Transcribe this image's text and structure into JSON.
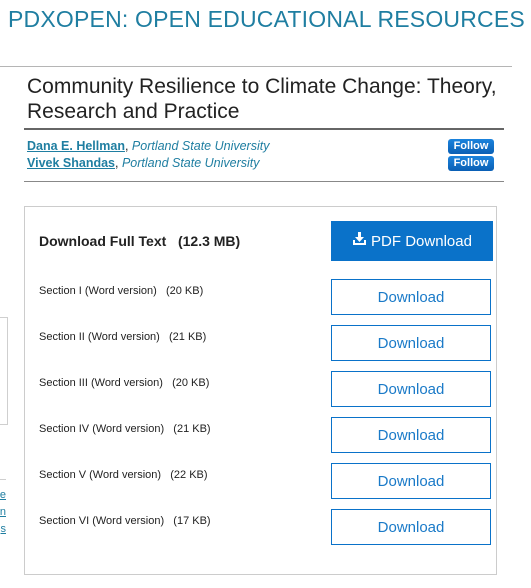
{
  "site": {
    "header": "PDXOPEN: OPEN EDUCATIONAL RESOURCES"
  },
  "book": {
    "title": "Community Resilience to Climate Change: Theory, Research and Practice"
  },
  "authors": [
    {
      "name": "Dana E. Hellman",
      "separator": ", ",
      "affiliation": "Portland State University",
      "follow_label": "Follow"
    },
    {
      "name": "Vivek Shandas",
      "separator": ", ",
      "affiliation": "Portland State University",
      "follow_label": "Follow"
    }
  ],
  "downloads": {
    "full_text_label": "Download Full Text",
    "full_text_size": "(12.3 MB)",
    "pdf_button_label": "PDF Download",
    "pdf_icon": "download-tray-icon",
    "sections": [
      {
        "label": "Section I (Word version)",
        "size": "(20 KB)",
        "button_label": "Download"
      },
      {
        "label": "Section II (Word version)",
        "size": "(21 KB)",
        "button_label": "Download"
      },
      {
        "label": "Section III (Word version)",
        "size": "(20 KB)",
        "button_label": "Download"
      },
      {
        "label": "Section IV (Word version)",
        "size": "(21 KB)",
        "button_label": "Download"
      },
      {
        "label": "Section V (Word version)",
        "size": "(22 KB)",
        "button_label": "Download"
      },
      {
        "label": "Section VI (Word version)",
        "size": "(17 KB)",
        "button_label": "Download"
      }
    ]
  },
  "left_fragments": {
    "links": [
      "e,",
      "n",
      "s"
    ]
  },
  "colors": {
    "brand": "#1f7ea1",
    "primary_button": "#0a72c9"
  }
}
